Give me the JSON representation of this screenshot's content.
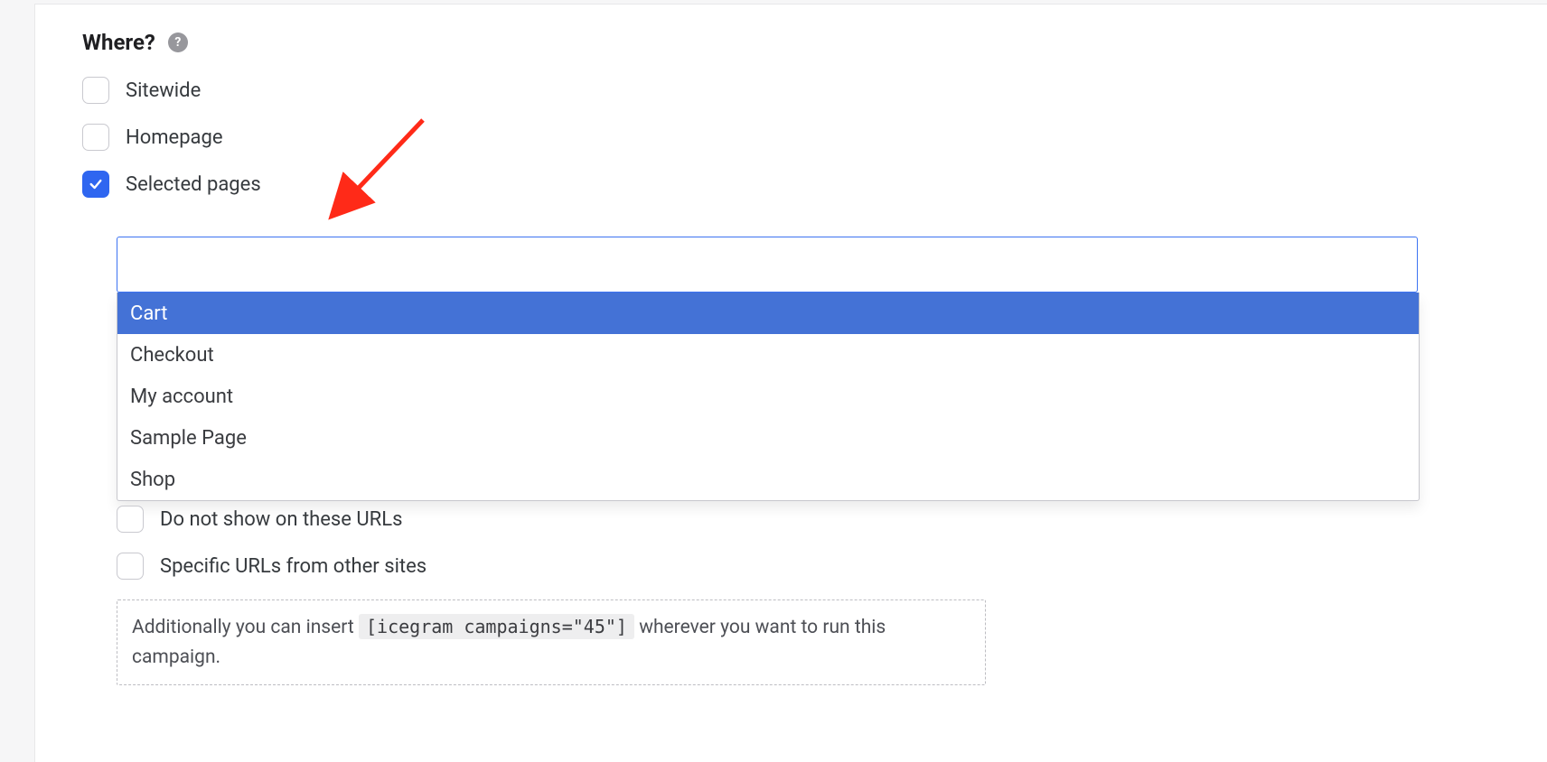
{
  "section": {
    "title": "Where?"
  },
  "options": {
    "sitewide": {
      "label": "Sitewide",
      "checked": false
    },
    "homepage": {
      "label": "Homepage",
      "checked": false
    },
    "selected": {
      "label": "Selected pages",
      "checked": true
    },
    "excludeUrls": {
      "label": "Do not show on these URLs",
      "checked": false
    },
    "otherSites": {
      "label": "Specific URLs from other sites",
      "checked": false
    }
  },
  "pageSelect": {
    "inputValue": "",
    "items": [
      {
        "label": "Cart",
        "highlighted": true
      },
      {
        "label": "Checkout",
        "highlighted": false
      },
      {
        "label": "My account",
        "highlighted": false
      },
      {
        "label": "Sample Page",
        "highlighted": false
      },
      {
        "label": "Shop",
        "highlighted": false
      }
    ]
  },
  "hint": {
    "pre": "Additionally you can insert ",
    "code": "[icegram campaigns=\"45\"]",
    "post": " wherever you want to run this campaign."
  },
  "annotation": {
    "arrowColor": "#ff2a18"
  }
}
